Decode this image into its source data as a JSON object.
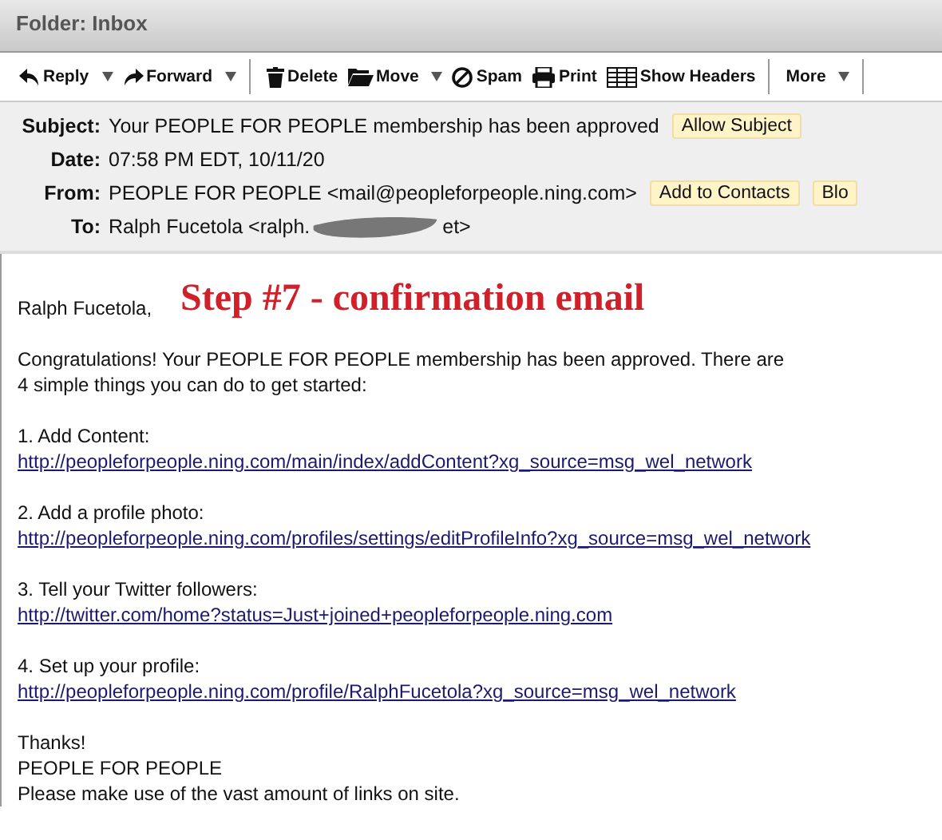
{
  "folder_title": "Folder: Inbox",
  "toolbar": [
    {
      "label": "Reply",
      "dropdown": true,
      "separator_after": false
    },
    {
      "label": "Forward",
      "dropdown": true,
      "separator_after": true
    },
    {
      "label": "Delete",
      "dropdown": false,
      "separator_after": false
    },
    {
      "label": "Move",
      "dropdown": true,
      "separator_after": false
    },
    {
      "label": "Spam",
      "dropdown": false,
      "separator_after": false
    },
    {
      "label": "Print",
      "dropdown": false,
      "separator_after": false
    },
    {
      "label": "Show Headers",
      "dropdown": false,
      "separator_after": true
    },
    {
      "label": "More",
      "dropdown": true,
      "separator_after": true
    }
  ],
  "headers": {
    "subject_label": "Subject:",
    "subject": "Your PEOPLE FOR PEOPLE membership has been approved",
    "subject_button": "Allow Subject",
    "date_label": "Date:",
    "date": "07:58 PM EDT, 10/11/20",
    "from_label": "From:",
    "from": "PEOPLE FOR PEOPLE <mail@peopleforpeople.ning.com>",
    "from_buttons": [
      "Add to Contacts",
      "Blo"
    ],
    "to_label": "To:",
    "to_start": "Ralph Fucetola <ralph.",
    "to_end": "et>"
  },
  "annotation": "Step #7 - confirmation email",
  "body": {
    "greeting": "Ralph Fucetola,",
    "intro": "Congratulations! Your PEOPLE FOR PEOPLE membership has been approved. There are\n4 simple things you can do to get started:",
    "steps": [
      {
        "title": "1. Add Content:",
        "link": "http://peopleforpeople.ning.com/main/index/addContent?xg_source=msg_wel_network"
      },
      {
        "title": "2. Add a profile photo:",
        "link": "http://peopleforpeople.ning.com/profiles/settings/editProfileInfo?xg_source=msg_wel_network"
      },
      {
        "title": "3. Tell your Twitter followers:",
        "link": "http://twitter.com/home?status=Just+joined+peopleforpeople.ning.com"
      },
      {
        "title": "4. Set up your profile:",
        "link": "http://peopleforpeople.ning.com/profile/RalphFucetola?xg_source=msg_wel_network"
      }
    ],
    "closing": [
      "Thanks!",
      "PEOPLE FOR PEOPLE",
      "Please make use of the vast amount of links on site."
    ]
  }
}
